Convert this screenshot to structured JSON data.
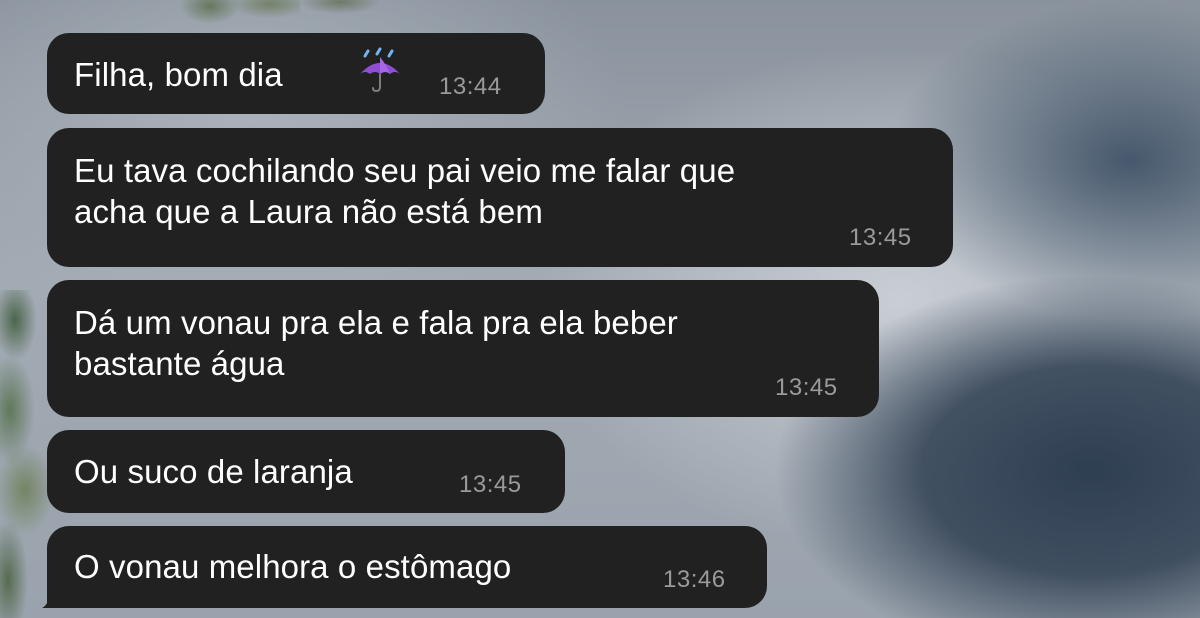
{
  "chat": {
    "messages": [
      {
        "text": "Filha, bom dia",
        "emoji": "umbrella-with-rain-icon",
        "time": "13:44"
      },
      {
        "text": "Eu tava cochilando seu pai veio me falar que\nacha que a Laura não está bem",
        "time": "13:45"
      },
      {
        "text": "Dá um vonau pra ela e fala pra ela beber\nbastante água",
        "time": "13:45"
      },
      {
        "text": "Ou suco de laranja",
        "time": "13:45"
      },
      {
        "text": "O vonau melhora o estômago",
        "time": "13:46"
      }
    ]
  },
  "colors": {
    "bubble": "#212121",
    "text": "#ffffff",
    "time": "#9a9a9a",
    "umbrella": "#8e4fd6"
  }
}
